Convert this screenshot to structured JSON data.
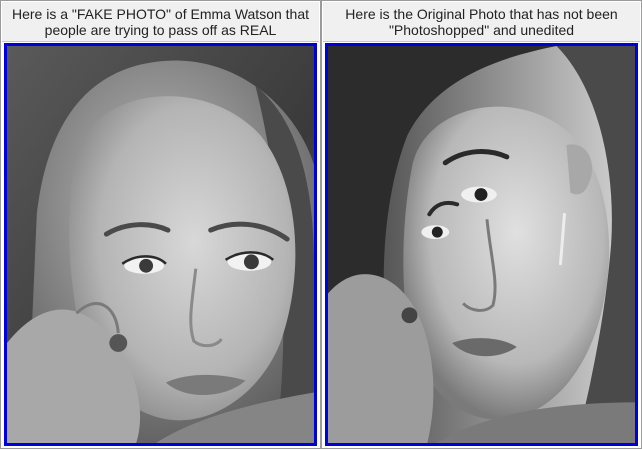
{
  "panels": [
    {
      "caption_line1": "Here is a \"FAKE PHOTO\" of Emma Watson that",
      "caption_line2": "people are trying to pass off as REAL",
      "image_name": "fake-photo-portrait",
      "frame_color": "#0000d8"
    },
    {
      "caption_line1": "Here is the Original Photo that has not been",
      "caption_line2": "\"Photoshopped\" and unedited",
      "image_name": "original-photo-portrait",
      "frame_color": "#0000d8"
    }
  ]
}
